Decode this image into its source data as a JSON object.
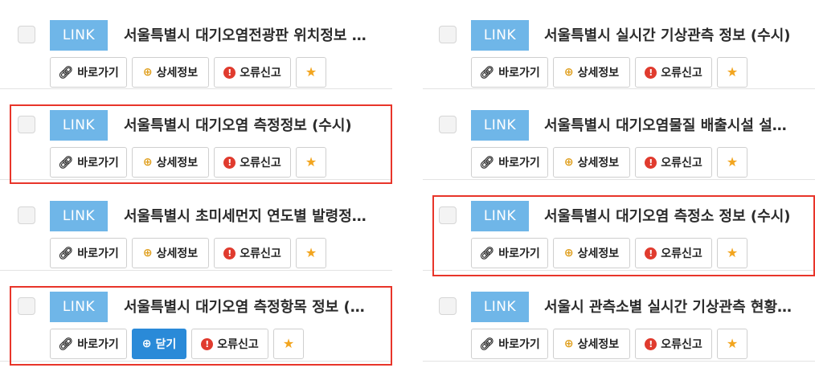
{
  "badge_label": "LINK",
  "buttons": {
    "go": "바로가기",
    "detail": "상세정보",
    "close": "닫기",
    "report": "오류신고"
  },
  "left_items": [
    {
      "title": "서울특별시 대기오염전광판 위치정보 …"
    },
    {
      "title": "서울특별시 대기오염 측정정보 (수시)"
    },
    {
      "title": "서울특별시 초미세먼지 연도별 발령정…"
    },
    {
      "title": "서울특별시 대기오염 측정항목 정보 (…"
    }
  ],
  "right_items": [
    {
      "title": "서울특별시 실시간 기상관측 정보 (수시)"
    },
    {
      "title": "서울특별시 대기오염물질 배출시설 설…"
    },
    {
      "title": "서울특별시 대기오염 측정소 정보 (수시)"
    },
    {
      "title": "서울시 관측소별 실시간 기상관측 현황…"
    }
  ],
  "colors": {
    "badge": "#6fb6e8",
    "highlight": "#e8352a",
    "close_button": "#2a8ad8",
    "star": "#f2a51f",
    "error_icon": "#e03b2e"
  }
}
